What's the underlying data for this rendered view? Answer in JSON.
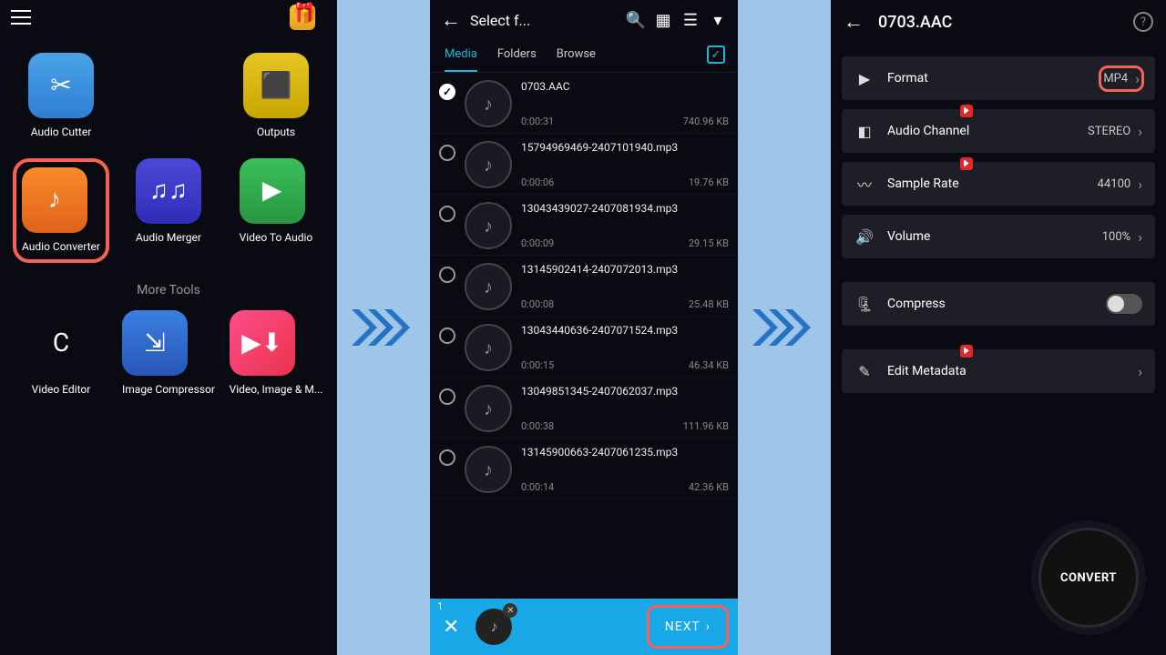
{
  "panel1": {
    "tiles": [
      {
        "label": "Audio Cutter",
        "cls": "ic-cutter",
        "glyph": "✂"
      },
      {
        "label": "Outputs",
        "cls": "ic-outputs",
        "glyph": "⬛"
      },
      {
        "label": "Audio Converter",
        "cls": "ic-converter",
        "glyph": "♪",
        "highlight": true
      },
      {
        "label": "Audio Merger",
        "cls": "ic-merger",
        "glyph": "♫♫"
      },
      {
        "label": "Video To Audio",
        "cls": "ic-v2a",
        "glyph": "▶"
      }
    ],
    "more_label": "More Tools",
    "more_tiles": [
      {
        "label": "Video Editor",
        "cls": "ic-veditor",
        "glyph": "C"
      },
      {
        "label": "Image Compressor",
        "cls": "ic-imgcomp",
        "glyph": "⇲"
      },
      {
        "label": "Video, Image & M...",
        "cls": "ic-vim",
        "glyph": "▶⬇"
      }
    ]
  },
  "panel2": {
    "title": "Select f...",
    "tabs": [
      "Media",
      "Folders",
      "Browse"
    ],
    "active_tab": 0,
    "files": [
      {
        "name": "0703.AAC",
        "dur": "0:00:31",
        "size": "740.96 KB",
        "checked": true
      },
      {
        "name": "15794969469-2407101940.mp3",
        "dur": "0:00:06",
        "size": "19.76 KB"
      },
      {
        "name": "13043439027-2407081934.mp3",
        "dur": "0:00:09",
        "size": "29.15 KB"
      },
      {
        "name": "13145902414-2407072013.mp3",
        "dur": "0:00:08",
        "size": "25.48 KB"
      },
      {
        "name": "13043440636-2407071524.mp3",
        "dur": "0:00:15",
        "size": "46.34 KB"
      },
      {
        "name": "13049851345-2407062037.mp3",
        "dur": "0:00:38",
        "size": "111.96 KB"
      },
      {
        "name": "13145900663-2407061235.mp3",
        "dur": "0:00:14",
        "size": "42.36 KB"
      }
    ],
    "count": "1",
    "next": "NEXT"
  },
  "panel3": {
    "title": "0703.AAC",
    "rows": [
      {
        "icon": "▶",
        "label": "Format",
        "value": "MP4",
        "highlight": true
      },
      {
        "icon": "◧",
        "label": "Audio Channel",
        "value": "STEREO",
        "dot": true
      },
      {
        "icon": "〰",
        "label": "Sample Rate",
        "value": "44100",
        "dot": true
      },
      {
        "icon": "🔊",
        "label": "Volume",
        "value": "100%"
      }
    ],
    "compress": {
      "icon": "🗜",
      "label": "Compress"
    },
    "metadata": {
      "icon": "✎",
      "label": "Edit Metadata",
      "dot": true
    },
    "convert": "CONVERT"
  }
}
